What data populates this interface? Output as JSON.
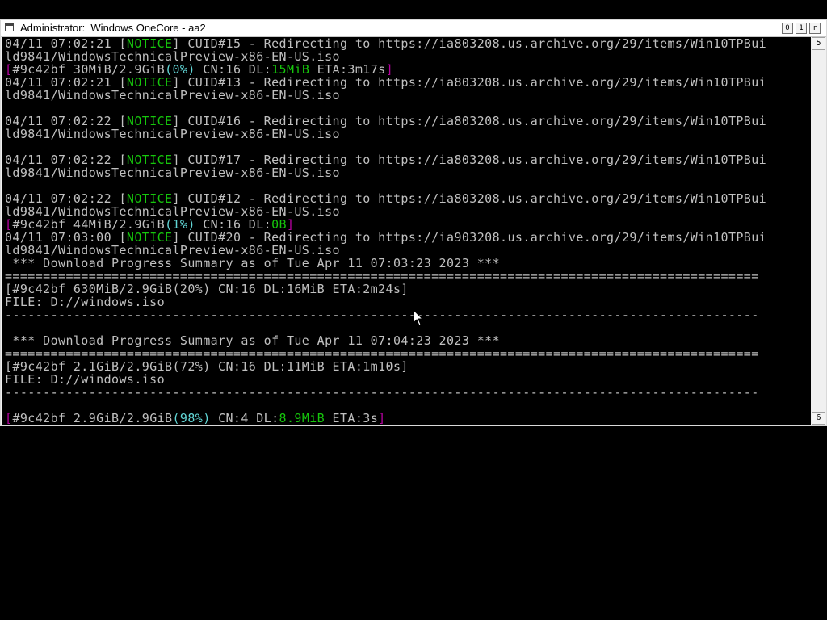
{
  "window": {
    "title": "Administrator:  Windows OneCore - aa2",
    "controls": {
      "minimize": "0",
      "maximize": "1",
      "close": "r"
    }
  },
  "scrollbar": {
    "up": "5",
    "down": "6"
  },
  "console": {
    "lines": [
      [
        {
          "t": "04/11 07:02:21 [",
          "c": "gray"
        },
        {
          "t": "NOTICE",
          "c": "green"
        },
        {
          "t": "] CUID#15 - Redirecting to https://ia803208.us.archive.org/29/items/Win10TPBui",
          "c": "gray"
        }
      ],
      [
        {
          "t": "ld9841/WindowsTechnicalPreview-x86-EN-US.iso",
          "c": "gray"
        }
      ],
      [
        {
          "t": "[",
          "c": "mag"
        },
        {
          "t": "#9c42bf 30MiB/2.9GiB",
          "c": "gray"
        },
        {
          "t": "(0%)",
          "c": "teal"
        },
        {
          "t": " CN:16 DL:",
          "c": "gray"
        },
        {
          "t": "15MiB",
          "c": "green"
        },
        {
          "t": " ETA:3m17s",
          "c": "gray"
        },
        {
          "t": "]",
          "c": "mag"
        }
      ],
      [
        {
          "t": "04/11 07:02:21 [",
          "c": "gray"
        },
        {
          "t": "NOTICE",
          "c": "green"
        },
        {
          "t": "] CUID#13 - Redirecting to https://ia803208.us.archive.org/29/items/Win10TPBui",
          "c": "gray"
        }
      ],
      [
        {
          "t": "ld9841/WindowsTechnicalPreview-x86-EN-US.iso",
          "c": "gray"
        }
      ],
      [],
      [
        {
          "t": "04/11 07:02:22 [",
          "c": "gray"
        },
        {
          "t": "NOTICE",
          "c": "green"
        },
        {
          "t": "] CUID#16 - Redirecting to https://ia803208.us.archive.org/29/items/Win10TPBui",
          "c": "gray"
        }
      ],
      [
        {
          "t": "ld9841/WindowsTechnicalPreview-x86-EN-US.iso",
          "c": "gray"
        }
      ],
      [],
      [
        {
          "t": "04/11 07:02:22 [",
          "c": "gray"
        },
        {
          "t": "NOTICE",
          "c": "green"
        },
        {
          "t": "] CUID#17 - Redirecting to https://ia803208.us.archive.org/29/items/Win10TPBui",
          "c": "gray"
        }
      ],
      [
        {
          "t": "ld9841/WindowsTechnicalPreview-x86-EN-US.iso",
          "c": "gray"
        }
      ],
      [],
      [
        {
          "t": "04/11 07:02:22 [",
          "c": "gray"
        },
        {
          "t": "NOTICE",
          "c": "green"
        },
        {
          "t": "] CUID#12 - Redirecting to https://ia803208.us.archive.org/29/items/Win10TPBui",
          "c": "gray"
        }
      ],
      [
        {
          "t": "ld9841/WindowsTechnicalPreview-x86-EN-US.iso",
          "c": "gray"
        }
      ],
      [
        {
          "t": "[",
          "c": "mag"
        },
        {
          "t": "#9c42bf 44MiB/2.9GiB",
          "c": "gray"
        },
        {
          "t": "(1%)",
          "c": "teal"
        },
        {
          "t": " CN:16 DL:",
          "c": "gray"
        },
        {
          "t": "0B",
          "c": "green"
        },
        {
          "t": "]",
          "c": "mag"
        }
      ],
      [
        {
          "t": "04/11 07:03:00 [",
          "c": "gray"
        },
        {
          "t": "NOTICE",
          "c": "green"
        },
        {
          "t": "] CUID#20 - Redirecting to https://ia903208.us.archive.org/29/items/Win10TPBui",
          "c": "gray"
        }
      ],
      [
        {
          "t": "ld9841/WindowsTechnicalPreview-x86-EN-US.iso",
          "c": "gray"
        }
      ],
      [
        {
          "t": " *** Download Progress Summary as of Tue Apr 11 07:03:23 2023 ***",
          "c": "gray"
        }
      ],
      [
        {
          "t": "===================================================================================================",
          "c": "gray"
        }
      ],
      [
        {
          "t": "[#9c42bf 630MiB/2.9GiB(20%) CN:16 DL:16MiB ETA:2m24s]",
          "c": "gray"
        }
      ],
      [
        {
          "t": "FILE: D://windows.iso",
          "c": "gray"
        }
      ],
      [
        {
          "t": "---------------------------------------------------------------------------------------------------",
          "c": "gray"
        }
      ],
      [],
      [
        {
          "t": " *** Download Progress Summary as of Tue Apr 11 07:04:23 2023 ***",
          "c": "gray"
        }
      ],
      [
        {
          "t": "===================================================================================================",
          "c": "gray"
        }
      ],
      [
        {
          "t": "[#9c42bf 2.1GiB/2.9GiB(72%) CN:16 DL:11MiB ETA:1m10s]",
          "c": "gray"
        }
      ],
      [
        {
          "t": "FILE: D://windows.iso",
          "c": "gray"
        }
      ],
      [
        {
          "t": "---------------------------------------------------------------------------------------------------",
          "c": "gray"
        }
      ],
      [],
      [
        {
          "t": "[",
          "c": "mag"
        },
        {
          "t": "#9c42bf 2.9GiB/2.9GiB",
          "c": "gray"
        },
        {
          "t": "(98%)",
          "c": "teal"
        },
        {
          "t": " CN:4 DL:",
          "c": "gray"
        },
        {
          "t": "8.9MiB",
          "c": "green"
        },
        {
          "t": " ETA:3s",
          "c": "gray"
        },
        {
          "t": "]",
          "c": "mag"
        }
      ]
    ]
  }
}
